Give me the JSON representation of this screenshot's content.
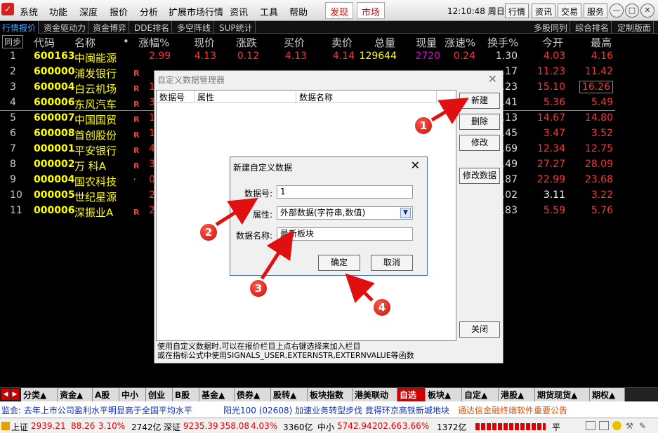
{
  "menubar": {
    "items": [
      "系统",
      "功能",
      "深度",
      "报价",
      "分析",
      "扩展市场行情",
      "资讯",
      "工具",
      "帮助"
    ],
    "highlight": [
      "发现",
      "市场"
    ],
    "clock": "12:10:48 周日",
    "right_buttons": [
      "行情",
      "资讯",
      "交易",
      "服务"
    ]
  },
  "tabbar": {
    "left": [
      "行情报价",
      "资金驱动力",
      "资金博弈",
      "DDE排名",
      "多空阵线",
      "SUP统计"
    ],
    "right": [
      "多股同列",
      "综合排名",
      "定制版面"
    ]
  },
  "table": {
    "sync_label": "同步",
    "headers": [
      "代码",
      "名称",
      "•",
      "涨幅%",
      "现价",
      "涨跌",
      "买价",
      "卖价",
      "总量",
      "现量",
      "涨速%",
      "换手%",
      "今开",
      "最高"
    ],
    "rows": [
      {
        "idx": "1",
        "code": "600163",
        "name": "中闽能源",
        "r": "",
        "pct": "2.99",
        "cur": "4.13",
        "chg": "0.12",
        "buy": "4.13",
        "sell": "4.14",
        "vol": "129644",
        "now": "2720",
        "spd": "0.24",
        "turn": "1.30",
        "open": "4.03",
        "high": "4.16"
      },
      {
        "idx": "2",
        "code": "600000",
        "name": "浦发银行",
        "r": "R",
        "pct": "",
        "cur": "",
        "chg": "",
        "buy": "",
        "sell": "",
        "vol": "",
        "now": "",
        "spd": "",
        "turn": ".17",
        "open": "11.23",
        "high": "11.42"
      },
      {
        "idx": "3",
        "code": "600004",
        "name": "白云机场",
        "r": "R",
        "pct": "10",
        "cur": "",
        "chg": "",
        "buy": "",
        "sell": "",
        "vol": "",
        "now": "",
        "spd": "",
        "turn": ".23",
        "open": "15.10",
        "high": "16.26"
      },
      {
        "idx": "4",
        "code": "600006",
        "name": "东风汽车",
        "r": "R",
        "pct": "3",
        "cur": "",
        "chg": "",
        "buy": "",
        "sell": "",
        "vol": "",
        "now": "",
        "spd": "",
        "turn": ".41",
        "open": "5.36",
        "high": "5.49"
      },
      {
        "idx": "5",
        "code": "600007",
        "name": "中国国贸",
        "r": "R",
        "pct": "1",
        "cur": "",
        "chg": "",
        "buy": "",
        "sell": "",
        "vol": "",
        "now": "",
        "spd": "",
        "turn": ".13",
        "open": "14.67",
        "high": "14.80"
      },
      {
        "idx": "6",
        "code": "600008",
        "name": "首创股份",
        "r": "R",
        "pct": "1",
        "cur": "",
        "chg": "",
        "buy": "",
        "sell": "",
        "vol": "",
        "now": "",
        "spd": "",
        "turn": ".45",
        "open": "3.47",
        "high": "3.52"
      },
      {
        "idx": "7",
        "code": "000001",
        "name": "平安银行",
        "r": "R",
        "pct": "4",
        "cur": "",
        "chg": "",
        "buy": "",
        "sell": "",
        "vol": "",
        "now": "",
        "spd": "",
        "turn": ".69",
        "open": "12.34",
        "high": "12.75"
      },
      {
        "idx": "8",
        "code": "000002",
        "name": "万 科A",
        "r": "R",
        "pct": "3",
        "cur": "",
        "chg": "",
        "buy": "",
        "sell": "",
        "vol": "",
        "now": "",
        "spd": "",
        "turn": ".49",
        "open": "27.27",
        "high": "28.09"
      },
      {
        "idx": "9",
        "code": "000004",
        "name": "国农科技",
        "r": "'",
        "pct": "0",
        "cur": "",
        "chg": "",
        "buy": "",
        "sell": "",
        "vol": "",
        "now": "",
        "spd": "",
        "turn": ".87",
        "open": "22.99",
        "high": "23.68"
      },
      {
        "idx": "10",
        "code": "000005",
        "name": "世纪星源",
        "r": "",
        "pct": "2",
        "cur": "",
        "chg": "",
        "buy": "",
        "sell": "",
        "vol": "",
        "now": "",
        "spd": "",
        "turn": ".02",
        "open": "3.11",
        "high": "3.22"
      },
      {
        "idx": "11",
        "code": "000006",
        "name": "深振业A",
        "r": "R",
        "pct": "2",
        "cur": "",
        "chg": "",
        "buy": "",
        "sell": "",
        "vol": "",
        "now": "",
        "spd": "",
        "turn": ".83",
        "open": "5.59",
        "high": "5.76"
      }
    ]
  },
  "dialog_manager": {
    "title": "自定义数据管理器",
    "columns": [
      "数据号",
      "属性",
      "数据名称"
    ],
    "buttons": {
      "new": "新建",
      "delete": "删除",
      "modify": "修改",
      "modify_data": "修改数据",
      "close": "关闭"
    },
    "footer_line1": "使用自定义数据时,可以在报价栏目上点右键选择来加入栏目",
    "footer_line2": "或在指标公式中使用SIGNALS_USER,EXTERNSTR,EXTERNVALUE等函数"
  },
  "dialog_new": {
    "title": "新建自定义数据",
    "label_id": "数据号:",
    "value_id": "1",
    "label_attr": "属性:",
    "value_attr": "外部数据(字符串,数值)",
    "label_name": "数据名称:",
    "value_name": "最新板块",
    "ok": "确定",
    "cancel": "取消"
  },
  "callouts": [
    "1",
    "2",
    "3",
    "4"
  ],
  "bottom_tabs": {
    "items": [
      "分类▲",
      "资金▲",
      "A股",
      "中小",
      "创业",
      "B股",
      "基金▲",
      "债券▲",
      "股转▲",
      "板块指数",
      "港美联动",
      "自选",
      "板块▲",
      "自定▲",
      "港股▲",
      "期货现货▲",
      "期权▲"
    ],
    "active_index": 11
  },
  "ticker": {
    "items": [
      "监会: 去年上市公司盈利水平明显高于全国平均水平",
      "阳光100 (02608) 加速业务转型步伐 竟得环京高铁新城地块",
      "通达信金融终端软件重要公告"
    ]
  },
  "status": {
    "sh_label": "上证",
    "sh_val": "2939.21",
    "sh_chg": "88.26",
    "sh_pct": "3.10%",
    "sh_amt": "2742亿",
    "sz_label": "深证",
    "sz_val": "9235.39",
    "sz_chg": "358.08",
    "sz_pct": "4.03%",
    "sz_amt": "3360亿",
    "zx_label": "中小",
    "zx_val": "5742.94",
    "zx_chg": "202.66",
    "zx_pct": "3.66%",
    "zx_amt": "1372亿",
    "flat": "平"
  },
  "colors": {
    "up": "#ff3333",
    "code": "#ffff00",
    "accent_red": "#cc0000",
    "dialog_bg": "#f0f0f0"
  }
}
